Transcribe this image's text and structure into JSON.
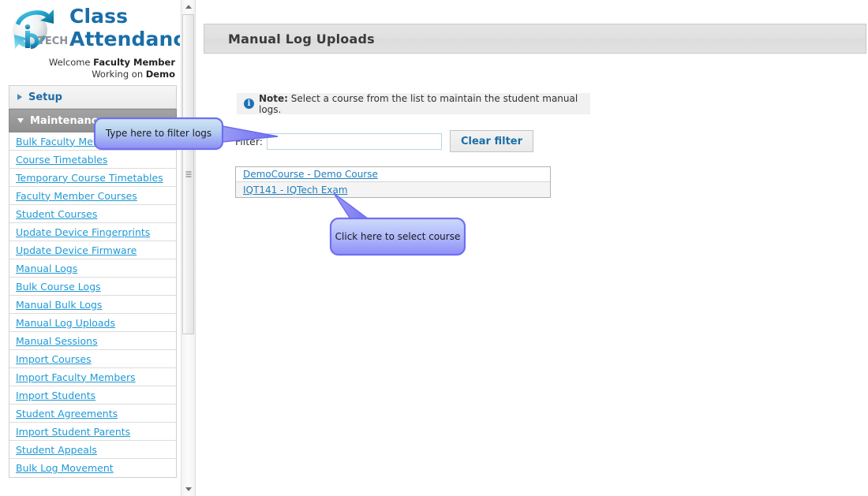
{
  "brand": {
    "logo_icon": "iqtech-globe-logo",
    "logo_wordmark": "TECH",
    "title_line1": "Class",
    "title_line2": "Attendance",
    "welcome_prefix": "Welcome ",
    "welcome_user": "Faculty Member",
    "working_prefix": "Working on ",
    "working_value": "Demo"
  },
  "sidebar": {
    "groups": [
      {
        "label": "Setup",
        "expanded": false,
        "icon": "chevron-right-icon"
      },
      {
        "label": "Maintenance",
        "expanded": true,
        "icon": "chevron-down-icon"
      }
    ],
    "items": [
      {
        "label": "Bulk Faculty Member Logs"
      },
      {
        "label": "Course Timetables"
      },
      {
        "label": "Temporary Course Timetables"
      },
      {
        "label": "Faculty Member Courses"
      },
      {
        "label": "Student Courses"
      },
      {
        "label": "Update Device Fingerprints"
      },
      {
        "label": "Update Device Firmware"
      },
      {
        "label": "Manual Logs"
      },
      {
        "label": "Bulk Course Logs"
      },
      {
        "label": "Manual Bulk Logs"
      },
      {
        "label": "Manual Log Uploads"
      },
      {
        "label": "Manual Sessions"
      },
      {
        "label": "Import Courses"
      },
      {
        "label": "Import Faculty Members"
      },
      {
        "label": "Import Students"
      },
      {
        "label": "Student Agreements"
      },
      {
        "label": "Import Student Parents"
      },
      {
        "label": "Student Appeals"
      },
      {
        "label": "Bulk Log Movement"
      }
    ]
  },
  "scrollbar": {
    "up_icon": "scroll-up-arrow-icon",
    "down_icon": "scroll-down-arrow-icon",
    "thumb_icon": "scrollbar-thumb-grip-icon"
  },
  "main": {
    "page_title": "Manual Log Uploads",
    "note": {
      "icon": "info-icon",
      "label": "Note:",
      "text": " Select a course from the list to maintain the student manual logs."
    },
    "filter": {
      "label": "Filter:",
      "value": "",
      "placeholder": "",
      "clear_label": "Clear filter"
    },
    "courses": [
      {
        "label": "DemoCourse - Demo Course"
      },
      {
        "label": "IQT141 - IQTech Exam"
      }
    ]
  },
  "callouts": [
    {
      "id": "filter-callout",
      "text": "Type here to filter logs"
    },
    {
      "id": "course-callout",
      "text": "Click here to select course"
    }
  ],
  "colors": {
    "brand_blue": "#1a6ea8",
    "link_blue": "#1f9ad6",
    "callout_fill": "#7b7bff",
    "note_icon_blue": "#1a72b8"
  }
}
